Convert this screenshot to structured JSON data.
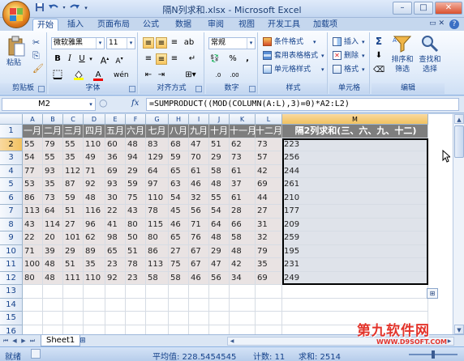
{
  "window": {
    "title": "隔N列求和.xlsx - Microsoft Excel",
    "controls": [
      "minimize",
      "maximize",
      "close"
    ]
  },
  "quick_access": {
    "icons": [
      "save-icon",
      "undo-icon",
      "redo-icon",
      "customize-icon"
    ]
  },
  "tabs": [
    "开始",
    "插入",
    "页面布局",
    "公式",
    "数据",
    "审阅",
    "视图",
    "开发工具",
    "加载项"
  ],
  "active_tab": "开始",
  "ribbon": {
    "clipboard": {
      "paste": "粘贴",
      "label": "剪贴板"
    },
    "font": {
      "name": "微软雅黑",
      "size": "11",
      "label": "字体"
    },
    "alignment": {
      "label": "对齐方式"
    },
    "number": {
      "format": "常规",
      "percent": "%",
      "comma": ",",
      "label": "数字"
    },
    "styles": {
      "conditional": "条件格式",
      "table": "套用表格格式",
      "cell": "单元格样式",
      "label": "样式"
    },
    "cells": {
      "insert": "插入",
      "delete": "删除",
      "format": "格式",
      "label": "单元格"
    },
    "editing": {
      "sum": "Σ",
      "sort": "排序和\n筛选",
      "find": "查找和\n选择",
      "label": "编辑"
    }
  },
  "formula_bar": {
    "name_box": "M2",
    "fx": "fx",
    "formula": "=SUMPRODUCT((MOD(COLUMN(A:L),3)=0)*A2:L2)"
  },
  "grid": {
    "columns": [
      "A",
      "B",
      "C",
      "D",
      "E",
      "F",
      "G",
      "H",
      "I",
      "J",
      "K",
      "L",
      "M"
    ],
    "rows": [
      "1",
      "2",
      "3",
      "4",
      "5",
      "6",
      "7",
      "8",
      "9",
      "10",
      "11",
      "12",
      "13",
      "14",
      "15",
      "16"
    ],
    "header_row": [
      "一月",
      "二月",
      "三月",
      "四月",
      "五月",
      "六月",
      "七月",
      "八月",
      "九月",
      "十月",
      "十一月",
      "十二月",
      "隔2列求和(三、六、九、十二)"
    ],
    "data": [
      [
        "55",
        "79",
        "55",
        "110",
        "60",
        "48",
        "83",
        "68",
        "47",
        "51",
        "62",
        "73",
        "223"
      ],
      [
        "54",
        "55",
        "35",
        "49",
        "36",
        "94",
        "129",
        "59",
        "70",
        "29",
        "73",
        "57",
        "256"
      ],
      [
        "77",
        "93",
        "112",
        "71",
        "69",
        "29",
        "64",
        "65",
        "61",
        "58",
        "61",
        "42",
        "244"
      ],
      [
        "53",
        "35",
        "87",
        "92",
        "93",
        "59",
        "97",
        "63",
        "46",
        "48",
        "37",
        "69",
        "261"
      ],
      [
        "86",
        "73",
        "59",
        "48",
        "30",
        "75",
        "110",
        "54",
        "32",
        "55",
        "61",
        "44",
        "210"
      ],
      [
        "113",
        "64",
        "51",
        "116",
        "22",
        "43",
        "78",
        "45",
        "56",
        "54",
        "28",
        "27",
        "177"
      ],
      [
        "43",
        "114",
        "27",
        "96",
        "41",
        "80",
        "115",
        "46",
        "71",
        "64",
        "66",
        "31",
        "209"
      ],
      [
        "22",
        "20",
        "101",
        "62",
        "98",
        "50",
        "80",
        "65",
        "76",
        "48",
        "58",
        "32",
        "259"
      ],
      [
        "71",
        "39",
        "29",
        "89",
        "65",
        "51",
        "86",
        "27",
        "67",
        "29",
        "48",
        "79",
        "195"
      ],
      [
        "100",
        "48",
        "51",
        "35",
        "23",
        "78",
        "113",
        "75",
        "67",
        "47",
        "42",
        "35",
        "231"
      ],
      [
        "80",
        "48",
        "111",
        "110",
        "92",
        "23",
        "58",
        "58",
        "46",
        "56",
        "34",
        "69",
        "249"
      ]
    ],
    "selected_cell": "M2"
  },
  "sheets": [
    "Sheet1"
  ],
  "status": {
    "mode": "就绪",
    "average": "平均值: 228.5454545",
    "count": "计数: 11",
    "sum": "求和: 2514"
  },
  "watermark": {
    "main": "第九软件网",
    "sub": "WWW.D9SOFT.COM"
  }
}
